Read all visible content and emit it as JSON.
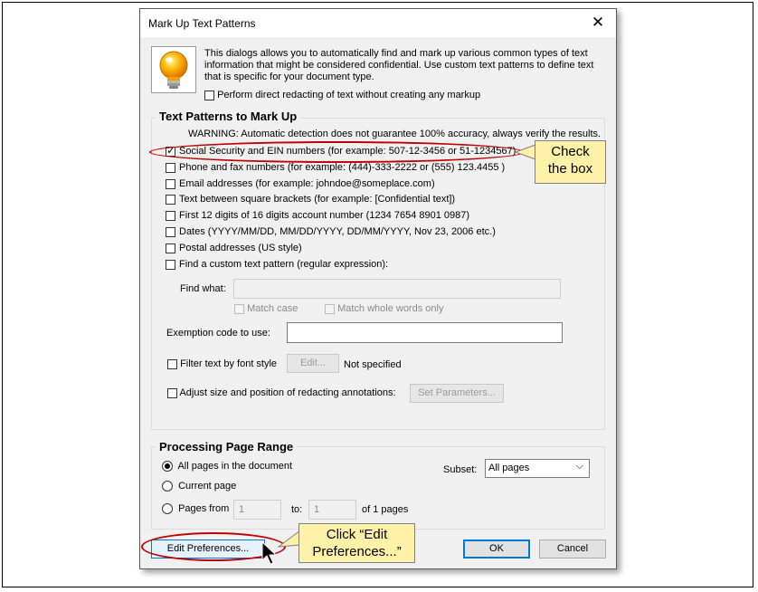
{
  "dialog": {
    "title": "Mark Up Text Patterns",
    "close_label": "✕",
    "intro_text": "This dialogs allows you to automatically find and mark up various common types of text information that might be considered confidential. Use custom text patterns to define text that is specific for your document type.",
    "direct_redact_label": "Perform direct redacting of text without creating any markup"
  },
  "patterns": {
    "title": "Text Patterns to Mark Up",
    "warning": "WARNING: Automatic detection does not guarantee 100% accuracy, always verify the results.",
    "items": [
      {
        "label": "Social Security and EIN numbers (for example: 507-12-3456 or 51-1234567)",
        "checked": true
      },
      {
        "label": "Phone and fax numbers (for example: (444)-333-2222 or (555) 123.4455 )",
        "checked": false
      },
      {
        "label": "Email addresses (for example: johndoe@someplace.com)",
        "checked": false
      },
      {
        "label": "Text between square brackets (for example: [Confidential text])",
        "checked": false
      },
      {
        "label": "First 12 digits of 16 digits account number (1234 7654 8901 0987)",
        "checked": false
      },
      {
        "label": "Dates (YYYY/MM/DD, MM/DD/YYYY, DD/MM/YYYY, Nov 23, 2006 etc.)",
        "checked": false
      },
      {
        "label": "Postal addresses (US style)",
        "checked": false
      },
      {
        "label": "Find a custom text pattern (regular expression):",
        "checked": false
      }
    ],
    "find_what_label": "Find what:",
    "find_what_value": "",
    "match_case_label": "Match case",
    "match_whole_label": "Match whole words only",
    "exemption_label": "Exemption code to use:",
    "exemption_value": "",
    "filter_font_label": "Filter text by font style",
    "filter_edit_button": "Edit...",
    "filter_status": "Not specified",
    "adjust_label": "Adjust size and position of redacting annotations:",
    "set_params_button": "Set Parameters..."
  },
  "page_range": {
    "title": "Processing Page Range",
    "all_pages_label": "All pages in the document",
    "current_page_label": "Current page",
    "pages_from_label": "Pages from",
    "from_value": "1",
    "to_label": "to:",
    "to_value": "1",
    "of_pages_label": "of 1 pages",
    "subset_label": "Subset:",
    "subset_value": "All pages",
    "selected": "all"
  },
  "footer": {
    "edit_prefs_button": "Edit Preferences...",
    "ok_button": "OK",
    "cancel_button": "Cancel"
  },
  "annotations": {
    "check_box_callout": [
      "Check",
      "the box"
    ],
    "edit_prefs_callout": [
      "Click “Edit",
      "Preferences...”"
    ],
    "highlight_color": "#c00000",
    "callout_color": "#fff2a8"
  }
}
